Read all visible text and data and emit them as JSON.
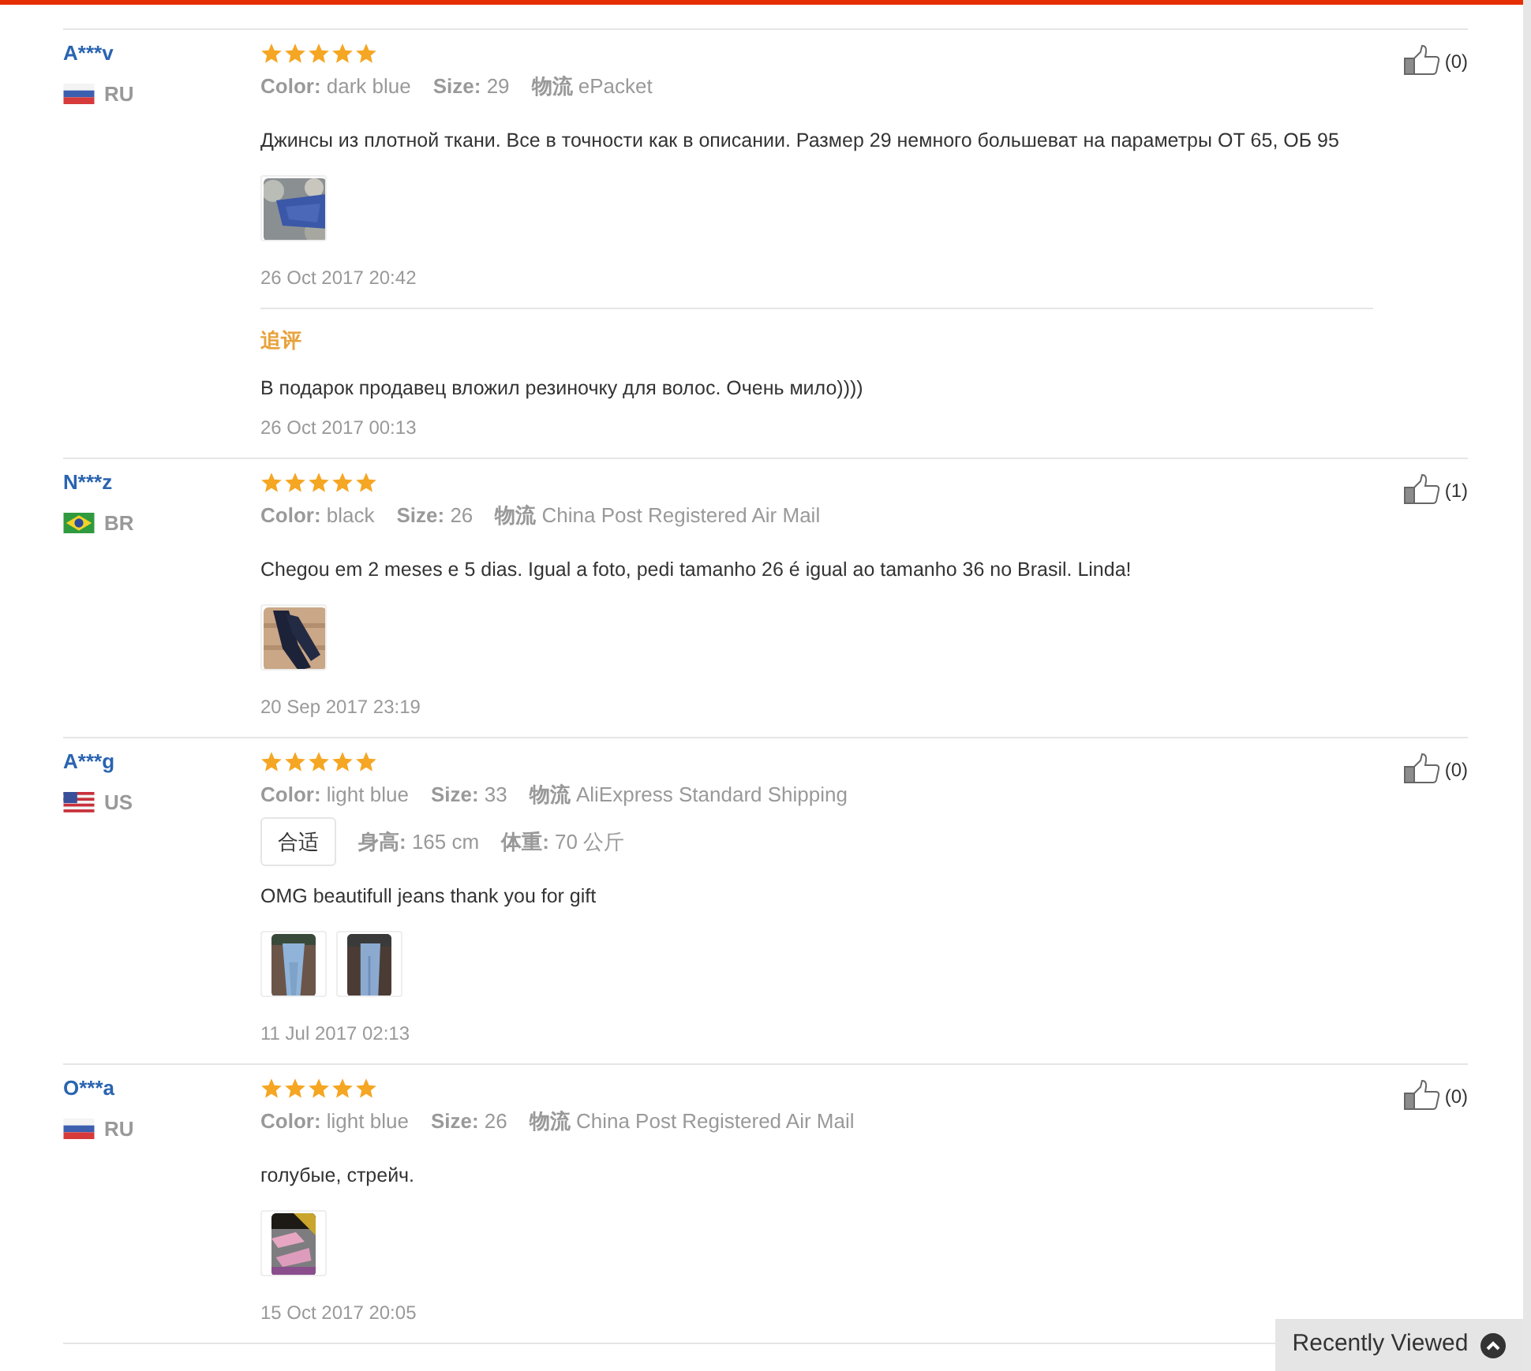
{
  "reviews": [
    {
      "name": "A***v",
      "country": "RU",
      "flag": {
        "kind": "ru"
      },
      "stars": 5,
      "likes": "(0)",
      "attributes": [
        {
          "label": "Color:",
          "value": "dark blue"
        },
        {
          "label": "Size:",
          "value": "29"
        },
        {
          "label": "物流",
          "value": "ePacket"
        }
      ],
      "text": "Джинсы из плотной ткани. Все в точности как в описании. Размер 29 немного большеват на параметры ОТ 65, ОБ 95",
      "photos": [
        {
          "kind": "picture"
        }
      ],
      "date": "26 Oct 2017 20:42",
      "followup": {
        "label": "追评",
        "text": "В подарок продавец вложил резиночку для волос. Очень мило))))",
        "date": "26 Oct 2017 00:13"
      }
    },
    {
      "name": "N***z",
      "country": "BR",
      "flag": {
        "kind": "br"
      },
      "stars": 5,
      "likes": "(1)",
      "attributes": [
        {
          "label": "Color:",
          "value": "black"
        },
        {
          "label": "Size:",
          "value": "26"
        },
        {
          "label": "物流",
          "value": "China Post Registered Air Mail"
        }
      ],
      "text": "Chegou em 2 meses e 5 dias. Igual a foto, pedi tamanho 26 é igual ao tamanho 36 no Brasil. Linda!",
      "photos": [
        {
          "kind": "picture"
        }
      ],
      "date": "20 Sep 2017 23:19"
    },
    {
      "name": "A***g",
      "country": "US",
      "flag": {
        "kind": "us"
      },
      "stars": 5,
      "likes": "(0)",
      "attributes": [
        {
          "label": "Color:",
          "value": "light blue"
        },
        {
          "label": "Size:",
          "value": "33"
        },
        {
          "label": "物流",
          "value": "AliExpress Standard Shipping"
        }
      ],
      "fit": {
        "tag": "合适",
        "attributes": [
          {
            "label": "身高:",
            "value": "165 cm"
          },
          {
            "label": "体重:",
            "value": "70 公斤"
          }
        ]
      },
      "text": "OMG beautifull jeans thank you for gift",
      "photos": [
        {
          "kind": "picture"
        },
        {
          "kind": "picture"
        }
      ],
      "date": "11 Jul 2017 02:13"
    },
    {
      "name": "O***a",
      "country": "RU",
      "flag": {
        "kind": "ru"
      },
      "stars": 5,
      "likes": "(0)",
      "attributes": [
        {
          "label": "Color:",
          "value": "light blue"
        },
        {
          "label": "Size:",
          "value": "26"
        },
        {
          "label": "物流",
          "value": "China Post Registered Air Mail"
        }
      ],
      "text": "голубые, стрейч.",
      "photos": [
        {
          "kind": "picture"
        }
      ],
      "date": "15 Oct 2017 20:05"
    }
  ],
  "recently_viewed": {
    "label": "Recently Viewed"
  }
}
